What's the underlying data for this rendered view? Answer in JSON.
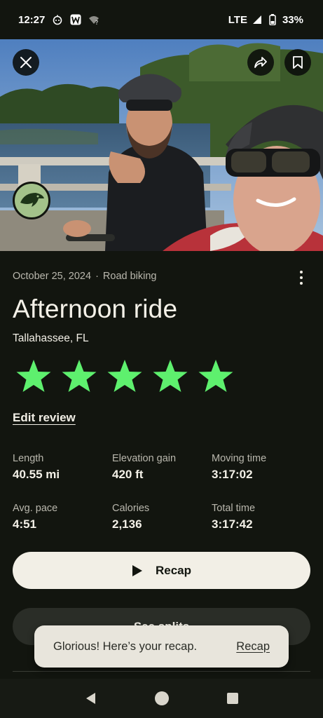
{
  "status_bar": {
    "time": "12:27",
    "network": "LTE",
    "battery": "33%",
    "icons": [
      "robot-notification-icon",
      "w-app-icon",
      "wifi-unknown-icon",
      "signal-icon",
      "battery-icon"
    ]
  },
  "hero": {
    "close_icon": "close-icon",
    "share_icon": "share-icon",
    "save_icon": "bookmark-icon"
  },
  "activity": {
    "date": "October 25, 2024",
    "separator": "·",
    "type": "Road biking",
    "title": "Afternoon ride",
    "location": "Tallahassee, FL",
    "rating": 5,
    "rating_max": 5,
    "star_color": "#5ef06e",
    "edit_review_label": "Edit review"
  },
  "stats": [
    {
      "label": "Length",
      "value": "40.55 mi"
    },
    {
      "label": "Elevation gain",
      "value": "420 ft"
    },
    {
      "label": "Moving time",
      "value": "3:17:02"
    },
    {
      "label": "Avg. pace",
      "value": "4:51"
    },
    {
      "label": "Calories",
      "value": "2,136"
    },
    {
      "label": "Total time",
      "value": "3:17:42"
    }
  ],
  "buttons": {
    "recap_label": "Recap",
    "splits_label": "See splits"
  },
  "snackbar": {
    "message": "Glorious! Here’s your recap.",
    "action": "Recap"
  },
  "nav": {
    "back_icon": "back-icon",
    "home_icon": "home-icon",
    "recents_icon": "recents-icon"
  },
  "colors": {
    "background": "#12150f",
    "primary_button": "#f2efe6",
    "secondary_button": "#2a2d27",
    "snackbar": "#e8e5dc"
  }
}
